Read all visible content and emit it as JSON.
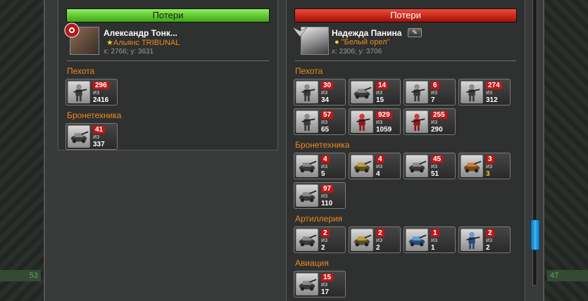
{
  "left_corner_value": "53",
  "right_corner_value": "47",
  "left": {
    "header": "Потери",
    "user": {
      "name": "Александр Тонк...",
      "alliance": "Альянс TRIBUNAL",
      "coords": "x: 2766; y: 3631"
    },
    "categories": [
      {
        "name": "Пехота",
        "units": [
          {
            "lost": "296",
            "of": "из",
            "total": "2416",
            "icon": "soldier-icon"
          }
        ]
      },
      {
        "name": "Бронетехника",
        "units": [
          {
            "lost": "41",
            "of": "из",
            "total": "337",
            "icon": "bike-icon"
          }
        ]
      }
    ]
  },
  "right": {
    "header": "Потери",
    "user": {
      "name": "Надежда Панина",
      "alliance": "\"Белый орел\"",
      "coords": "x: 2306; y: 3706"
    },
    "categories": [
      {
        "name": "Пехота",
        "units": [
          {
            "lost": "30",
            "of": "из",
            "total": "34",
            "icon": "soldier-icon"
          },
          {
            "lost": "14",
            "of": "из",
            "total": "15",
            "icon": "crawler-icon"
          },
          {
            "lost": "6",
            "of": "из",
            "total": "7",
            "icon": "mech-soldier-icon"
          },
          {
            "lost": "274",
            "of": "из",
            "total": "312",
            "icon": "rifleman-icon"
          },
          {
            "lost": "57",
            "of": "из",
            "total": "65",
            "icon": "heavy-soldier-icon"
          },
          {
            "lost": "929",
            "of": "из",
            "total": "1059",
            "icon": "red-soldier-icon"
          },
          {
            "lost": "255",
            "of": "из",
            "total": "290",
            "icon": "red-mech-icon"
          }
        ]
      },
      {
        "name": "Бронетехника",
        "units": [
          {
            "lost": "4",
            "of": "из",
            "total": "5",
            "icon": "buggy-icon"
          },
          {
            "lost": "4",
            "of": "из",
            "total": "4",
            "icon": "tank-icon"
          },
          {
            "lost": "45",
            "of": "из",
            "total": "51",
            "icon": "walker-icon"
          },
          {
            "lost": "3",
            "of": "из",
            "total": "3",
            "icon": "crab-tank-icon",
            "highlight": true
          },
          {
            "lost": "97",
            "of": "из",
            "total": "110",
            "icon": "bike-icon"
          }
        ]
      },
      {
        "name": "Артиллерия",
        "units": [
          {
            "lost": "2",
            "of": "из",
            "total": "2",
            "icon": "artillery-icon"
          },
          {
            "lost": "2",
            "of": "из",
            "total": "2",
            "icon": "launcher-icon"
          },
          {
            "lost": "1",
            "of": "из",
            "total": "1",
            "icon": "blue-artillery-icon"
          },
          {
            "lost": "2",
            "of": "из",
            "total": "2",
            "icon": "blue-mech-icon"
          }
        ]
      },
      {
        "name": "Авиация",
        "units": [
          {
            "lost": "15",
            "of": "из",
            "total": "17",
            "icon": "aircraft-icon"
          }
        ]
      }
    ]
  },
  "colors": {
    "accent_orange": "#f08a1c",
    "loss_red": "#c21515",
    "header_green": "#5cc832",
    "header_red": "#d12a1c",
    "scroll_blue": "#40b4f0"
  }
}
